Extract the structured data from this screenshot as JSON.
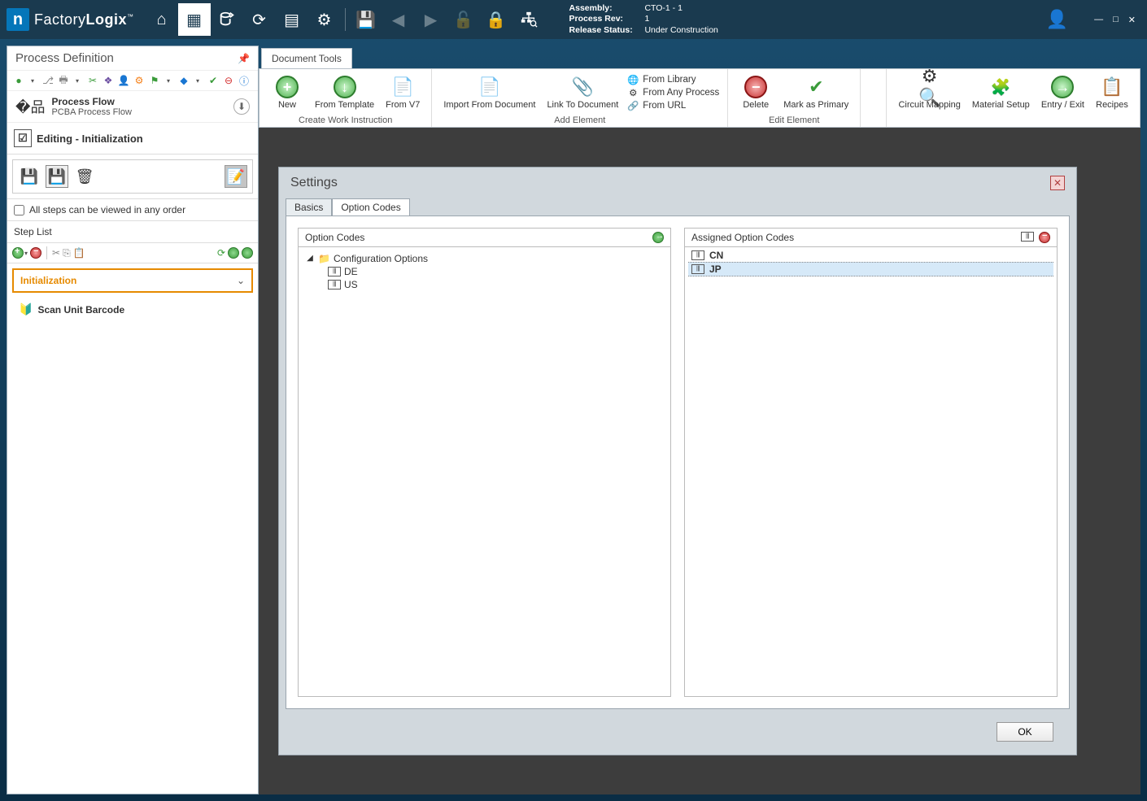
{
  "app": {
    "name_light": "Factory",
    "name_bold": "Logix"
  },
  "assembly_info": {
    "assembly_label": "Assembly:",
    "assembly_value": "CTO-1 - 1",
    "rev_label": "Process Rev:",
    "rev_value": "1",
    "status_label": "Release Status:",
    "status_value": "Under Construction"
  },
  "left_panel": {
    "title": "Process Definition",
    "flow_title": "Process Flow",
    "flow_subtitle": "PCBA Process Flow",
    "editing_label": "Editing - Initialization",
    "any_order_label": "All steps can be viewed in any order",
    "step_list_label": "Step List",
    "steps": [
      {
        "label": "Initialization",
        "active": true
      },
      {
        "label": "Scan Unit Barcode",
        "active": false
      }
    ]
  },
  "ribbon": {
    "tab": "Document Tools",
    "create_group": {
      "new": "New",
      "from_template": "From Template",
      "from_v7": "From V7",
      "caption": "Create Work Instruction"
    },
    "add_group": {
      "import": "Import From Document",
      "linkto": "Link To Document",
      "library": "From Library",
      "anyproc": "From Any Process",
      "url": "From URL",
      "caption": "Add Element"
    },
    "edit_group": {
      "delete": "Delete",
      "markprim": "Mark as Primary",
      "caption": "Edit Element"
    },
    "right_group": {
      "circuit": "Circuit Mapping",
      "material": "Material Setup",
      "entry": "Entry / Exit",
      "recipes": "Recipes"
    }
  },
  "settings": {
    "title": "Settings",
    "tabs": [
      {
        "label": "Basics",
        "active": false
      },
      {
        "label": "Option Codes",
        "active": true
      }
    ],
    "option_codes_hdr": "Option Codes",
    "tree_root": "Configuration Options",
    "available": [
      "DE",
      "US"
    ],
    "assigned_hdr": "Assigned Option Codes",
    "assigned": [
      "CN",
      "JP"
    ],
    "ok_label": "OK"
  }
}
